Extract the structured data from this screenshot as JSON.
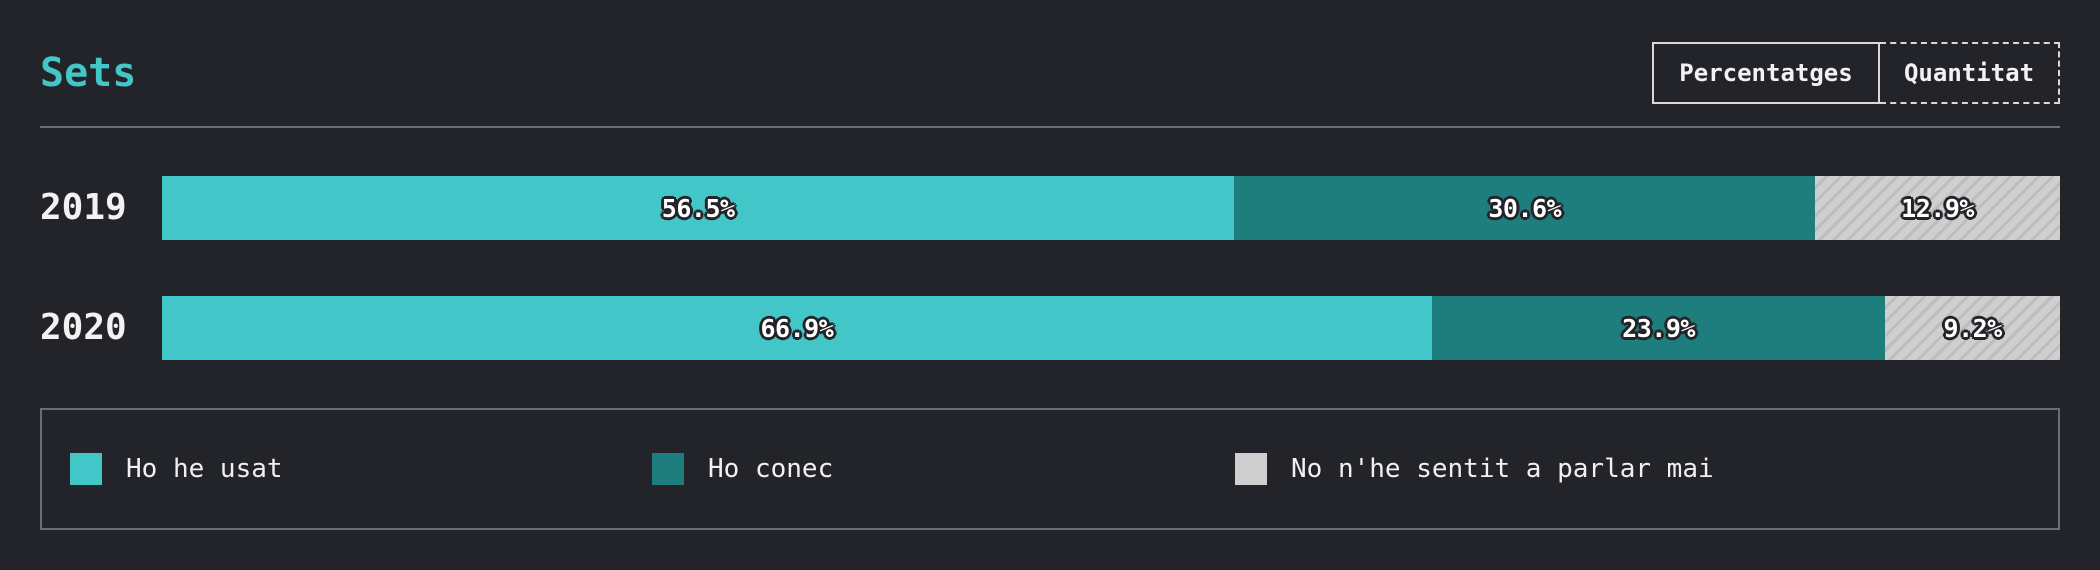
{
  "title": "Sets",
  "toggle": {
    "percentages_label": "Percentatges",
    "quantity_label": "Quantitat"
  },
  "colors": {
    "used": "#43c6c8",
    "known": "#1e7d7d",
    "never": "#cfcfcf",
    "background": "#232429"
  },
  "chart_data": {
    "type": "bar",
    "orientation": "horizontal",
    "stacked": true,
    "normalized_percent": true,
    "categories": [
      "2019",
      "2020"
    ],
    "series": [
      {
        "name": "Ho he usat",
        "values": [
          56.5,
          66.9
        ],
        "labels": [
          "56.5%",
          "66.9%"
        ],
        "color": "#43c6c8",
        "pattern": "solid"
      },
      {
        "name": "Ho conec",
        "values": [
          30.6,
          23.9
        ],
        "labels": [
          "30.6%",
          "23.9%"
        ],
        "color": "#1e7d7d",
        "pattern": "solid"
      },
      {
        "name": "No n'he sentit a parlar mai",
        "values": [
          12.9,
          9.2
        ],
        "labels": [
          "12.9%",
          "9.2%"
        ],
        "color": "#cfcfcf",
        "pattern": "diagonal-stripes"
      }
    ],
    "legend_position": "bottom",
    "grid": false
  }
}
